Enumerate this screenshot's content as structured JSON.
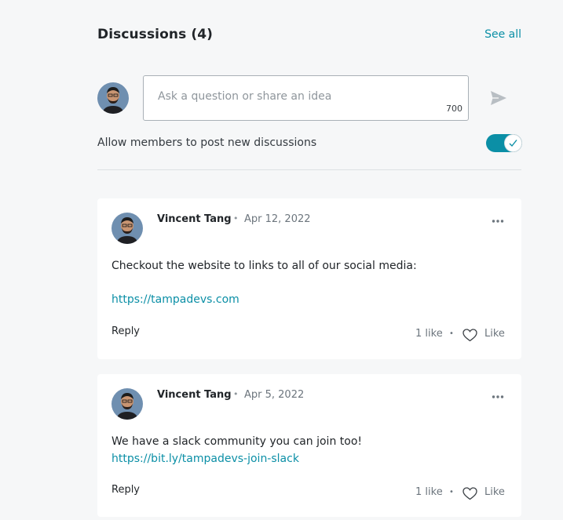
{
  "header": {
    "title": "Discussions (4)",
    "see_all": "See all"
  },
  "composer": {
    "placeholder": "Ask a question or share an idea",
    "char_limit": "700"
  },
  "settings": {
    "allow_label": "Allow members to post new discussions",
    "allow_enabled": true
  },
  "posts": [
    {
      "author": "Vincent Tang",
      "separator": "•",
      "date": "Apr 12, 2022",
      "text": "Checkout the website to links to all of our social media:",
      "link": "https://tampadevs.com",
      "reply_label": "Reply",
      "like_count": "1 like",
      "like_label": "Like"
    },
    {
      "author": "Vincent Tang",
      "separator": "•",
      "date": "Apr 5, 2022",
      "text": "We have a slack community you can join too!",
      "link": "https://bit.ly/tampadevs-join-slack",
      "reply_label": "Reply",
      "like_count": "1 like",
      "like_label": "Like"
    }
  ],
  "colors": {
    "accent": "#0b8fa6",
    "background": "#f6f7f8",
    "card": "#ffffff"
  },
  "icons": {
    "send": "send-icon",
    "more": "more-options-icon",
    "heart": "heart-icon",
    "check": "check-icon"
  }
}
